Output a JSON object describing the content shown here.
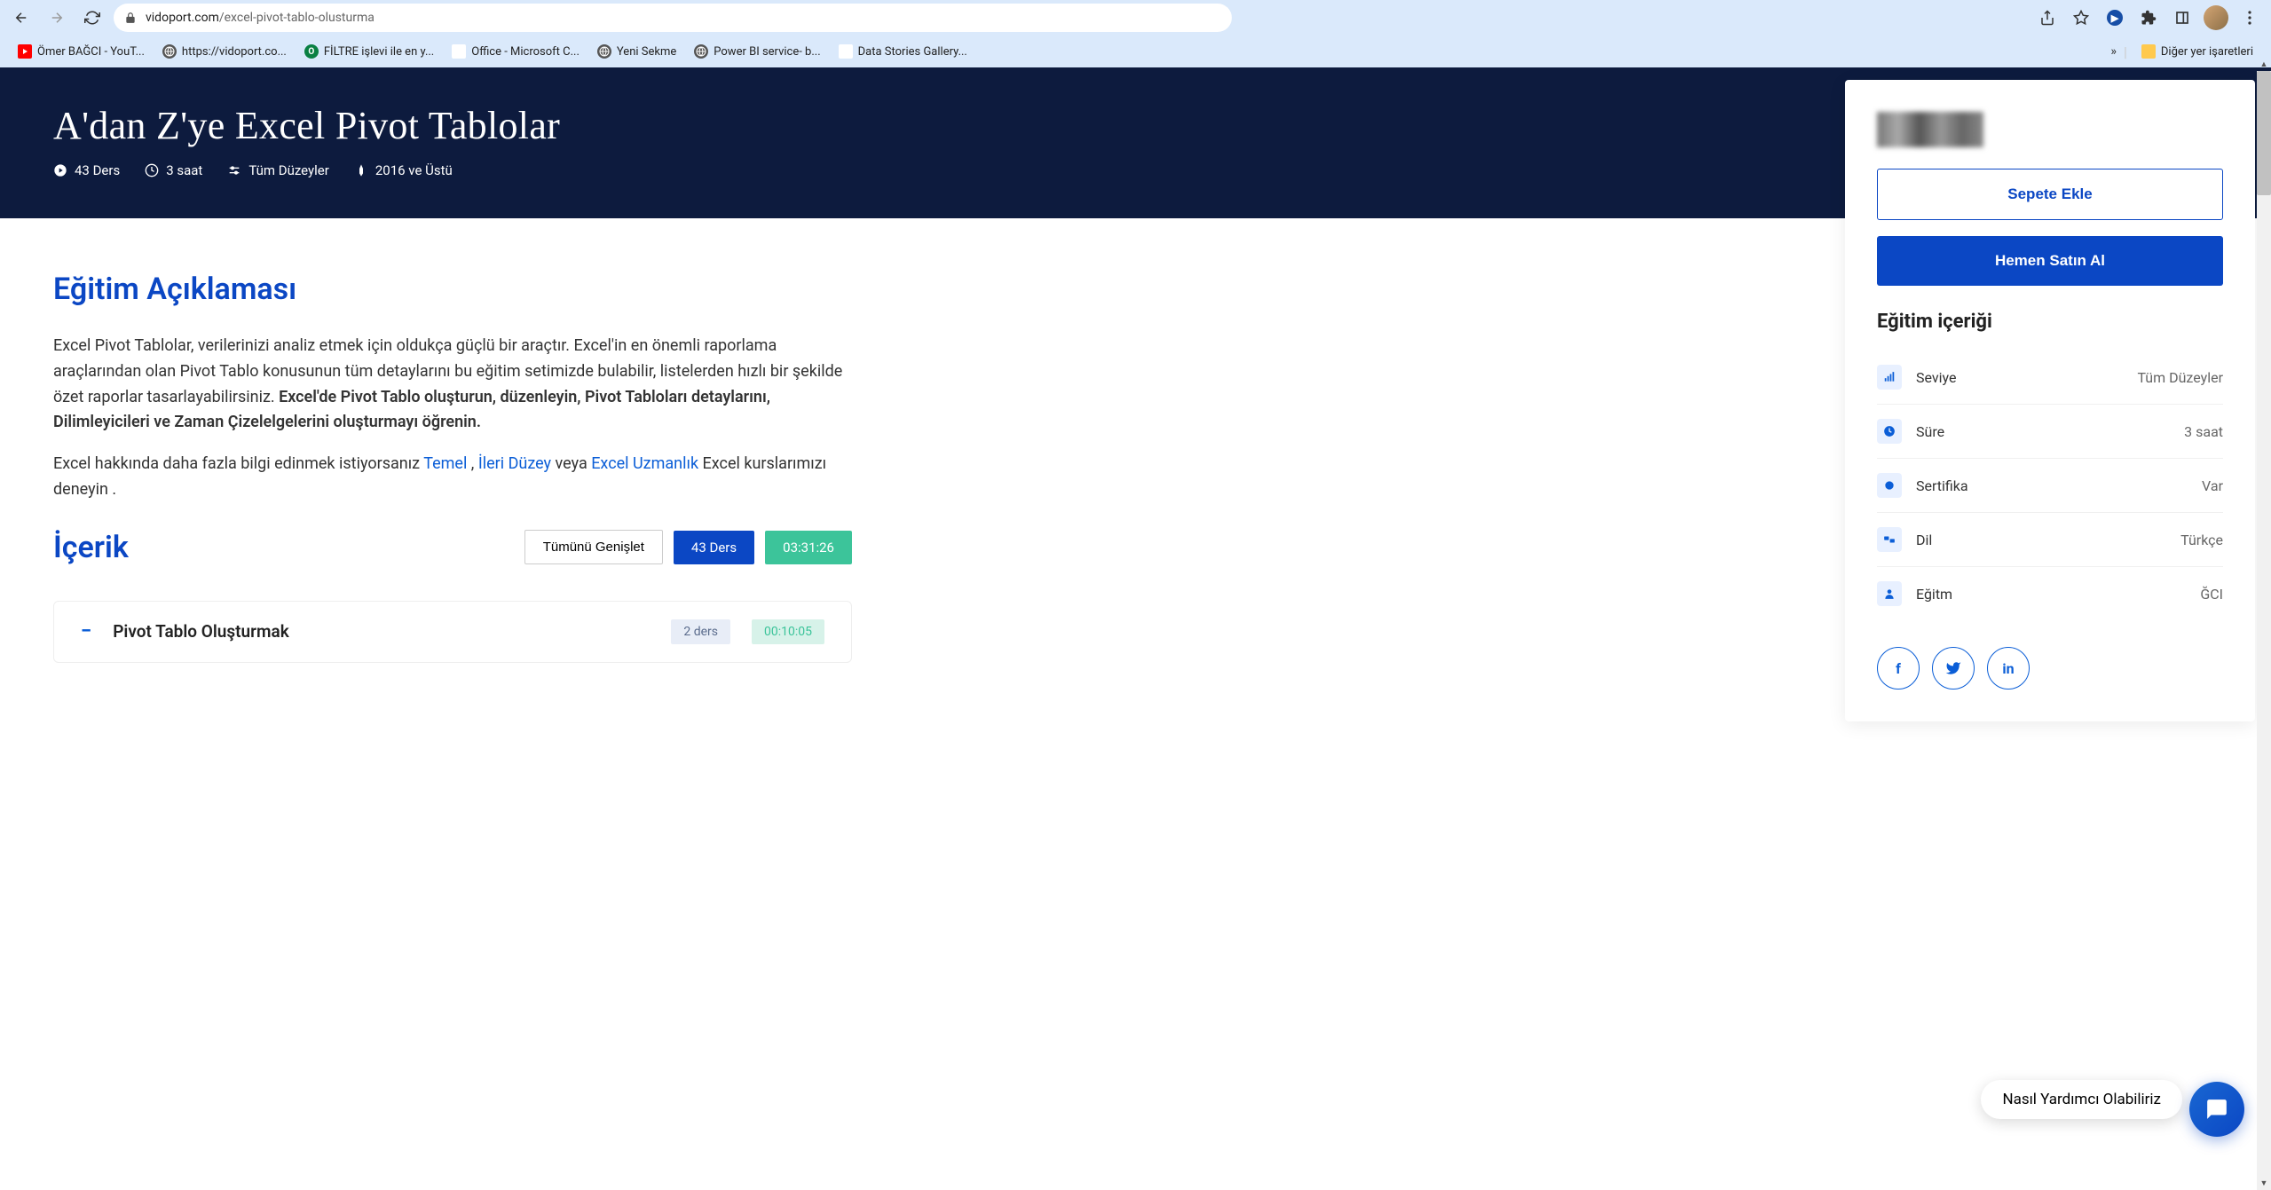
{
  "browser": {
    "url_domain": "vidoport.com",
    "url_path": "/excel-pivot-tablo-olusturma",
    "bookmarks": [
      {
        "label": "Ömer BAĞCI - YouT...",
        "icon": "yt"
      },
      {
        "label": "https://vidoport.co...",
        "icon": "globe"
      },
      {
        "label": "FİLTRE işlevi ile en y...",
        "icon": "green-o"
      },
      {
        "label": "Office - Microsoft C...",
        "icon": "ms"
      },
      {
        "label": "Yeni Sekme",
        "icon": "globe"
      },
      {
        "label": "Power BI service- b...",
        "icon": "globe"
      },
      {
        "label": "Data Stories Gallery...",
        "icon": "ms"
      }
    ],
    "other_bookmarks": "Diğer yer işaretleri"
  },
  "hero": {
    "title": "A'dan Z'ye Excel Pivot Tablolar",
    "meta": {
      "lessons": "43 Ders",
      "duration": "3 saat",
      "level": "Tüm Düzeyler",
      "version": "2016 ve Üstü"
    }
  },
  "description": {
    "heading": "Eğitim Açıklaması",
    "p1_a": "Excel Pivot Tablolar, verilerinizi analiz etmek için oldukça güçlü bir araçtır. Excel'in en önemli raporlama araçlarından olan Pivot Tablo konusunun tüm detaylarını bu eğitim setimizde bulabilir, listelerden hızlı bir şekilde özet raporlar tasarlayabilirsiniz. ",
    "p1_b": "Excel'de Pivot Tablo oluşturun, düzenleyin, Pivot Tabloları detaylarını, Dilimleyicileri ve Zaman Çizelelgelerini oluşturmayı öğrenin.",
    "p2_a": "Excel hakkında daha fazla bilgi edinmek istiyorsanız ",
    "p2_link1": "Temel",
    "p2_b": " , ",
    "p2_link2": "İleri Düzey",
    "p2_c": " veya ",
    "p2_link3": "Excel Uzmanlık",
    "p2_d": " Excel kurslarımızı deneyin ."
  },
  "content": {
    "heading": "İçerik",
    "expand_all": "Tümünü Genişlet",
    "total_lessons": "43 Ders",
    "total_duration": "03:31:26",
    "section1": {
      "title": "Pivot Tablo Oluşturmak",
      "count": "2 ders",
      "duration": "00:10:05"
    }
  },
  "sidebar": {
    "add_to_cart": "Sepete Ekle",
    "buy_now": "Hemen Satın Al",
    "content_heading": "Eğitim içeriği",
    "rows": [
      {
        "icon": "📶",
        "label": "Seviye",
        "value": "Tüm Düzeyler"
      },
      {
        "icon": "🕐",
        "label": "Süre",
        "value": "3 saat"
      },
      {
        "icon": "✸",
        "label": "Sertifika",
        "value": "Var"
      },
      {
        "icon": "A⇄",
        "label": "Dil",
        "value": "Türkçe"
      },
      {
        "icon": "👤",
        "label": "Eğitm",
        "value": "ĞCI"
      }
    ]
  },
  "chat": {
    "tooltip": "Nasıl Yardımcı Olabiliriz"
  }
}
